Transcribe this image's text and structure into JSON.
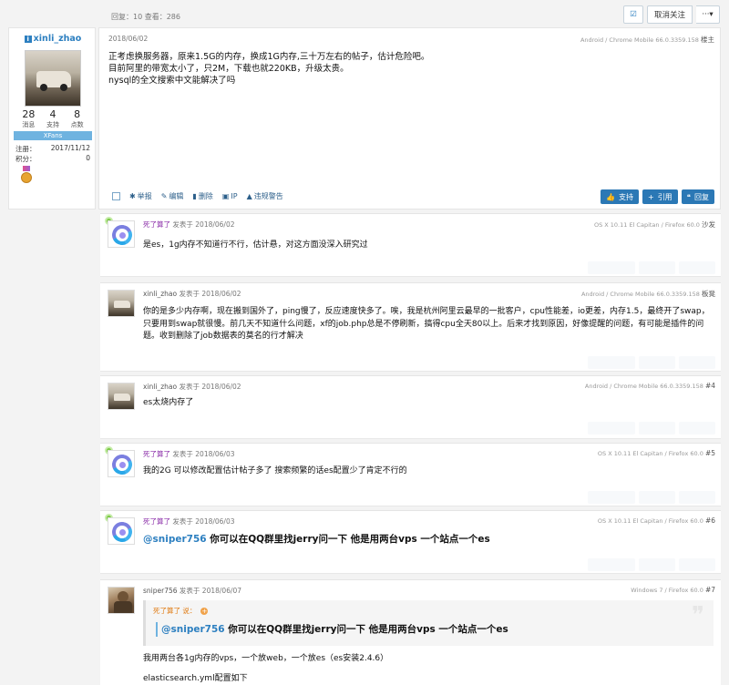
{
  "topbar": {
    "stats": "回复：10  查看：286",
    "check_icon": "check-square-icon",
    "cancel_follow": "取消关注",
    "more": "···▾"
  },
  "first_post": {
    "user": {
      "icon": "user-badge-icon",
      "name": "xinli_zhao",
      "messages": "28",
      "messages_label": "消息",
      "support": "4",
      "support_label": "支持",
      "points": "8",
      "points_label": "点数",
      "group": "XFans",
      "register_label": "注册：",
      "register_date": "2017/11/12",
      "score_label": "积分：",
      "score": "0"
    },
    "date": "2018/06/02",
    "device": "Android / Chrome Mobile 66.0.3359.158",
    "floor": "楼主",
    "lines": [
      "正考虑换服务器，原来1.5G的内存，换成1G内存,三十万左右的帖子，估计危险吧。",
      "目前阿里的带宽太小了，只2M，下载也就220KB，升级太贵。",
      "nysql的全文搜索中文能解决了吗"
    ],
    "actions": {
      "report": "举报",
      "edit": "编辑",
      "delete": "删除",
      "ip": "IP",
      "warn": "违规警告"
    },
    "buttons": {
      "support": "支持",
      "quote": "引用",
      "reply": "回复"
    }
  },
  "replies": [
    {
      "author": "死了算了",
      "posted": "发表于 2018/06/02",
      "device": "OS X 10.11 El Capitan / Firefox 60.0",
      "floor": "沙发",
      "text": "是es，1g内存不知道行不行，估计悬，对这方面没深入研究过"
    },
    {
      "author": "xinli_zhao",
      "posted": "发表于 2018/06/02",
      "device": "Android / Chrome Mobile 66.0.3359.158",
      "floor": "板凳",
      "text": "你的是多少内存啊，现在搬到国外了，ping慢了，反应速度快多了。唉，我是杭州阿里云最早的一批客户，cpu性能差，io更差，内存1.5，最终开了swap，只要用到swap就很慢。前几天不知道什么问题，xf的job.php总是不停刷新，搞得cpu全天80以上。后来才找到原因，好像提醒的问题，有可能是插件的问题。收到删除了job数据表的莫名的行才解决"
    },
    {
      "author": "xinli_zhao",
      "posted": "发表于 2018/06/02",
      "device": "Android / Chrome Mobile 66.0.3359.158",
      "floor": "#4",
      "text": "es太烧内存了"
    },
    {
      "author": "死了算了",
      "posted": "发表于 2018/06/03",
      "device": "OS X 10.11 El Capitan / Firefox 60.0",
      "floor": "#5",
      "text": "我的2G 可以修改配置估计帖子多了 搜索频繁的话es配置少了肯定不行的"
    },
    {
      "author": "死了算了",
      "posted": "发表于 2018/06/03",
      "device": "OS X 10.11 El Capitan / Firefox 60.0",
      "floor": "#6",
      "mention": "@sniper756",
      "text": " 你可以在QQ群里找jerry问一下 他是用两台vps 一个站点一个es"
    },
    {
      "author": "sniper756",
      "posted": "发表于 2018/06/07",
      "device": "Windows 7 / Firefox 60.0",
      "floor": "#7",
      "quote_author": "死了算了 说：",
      "quote_mention": "@sniper756",
      "quote_text": " 你可以在QQ群里找jerry问一下 他是用两台vps 一个站点一个es",
      "line1": "我用两台各1g内存的vps，一个放web，一个放es（es安装2.4.6）",
      "line2": "elasticsearch.yml配置如下"
    }
  ]
}
